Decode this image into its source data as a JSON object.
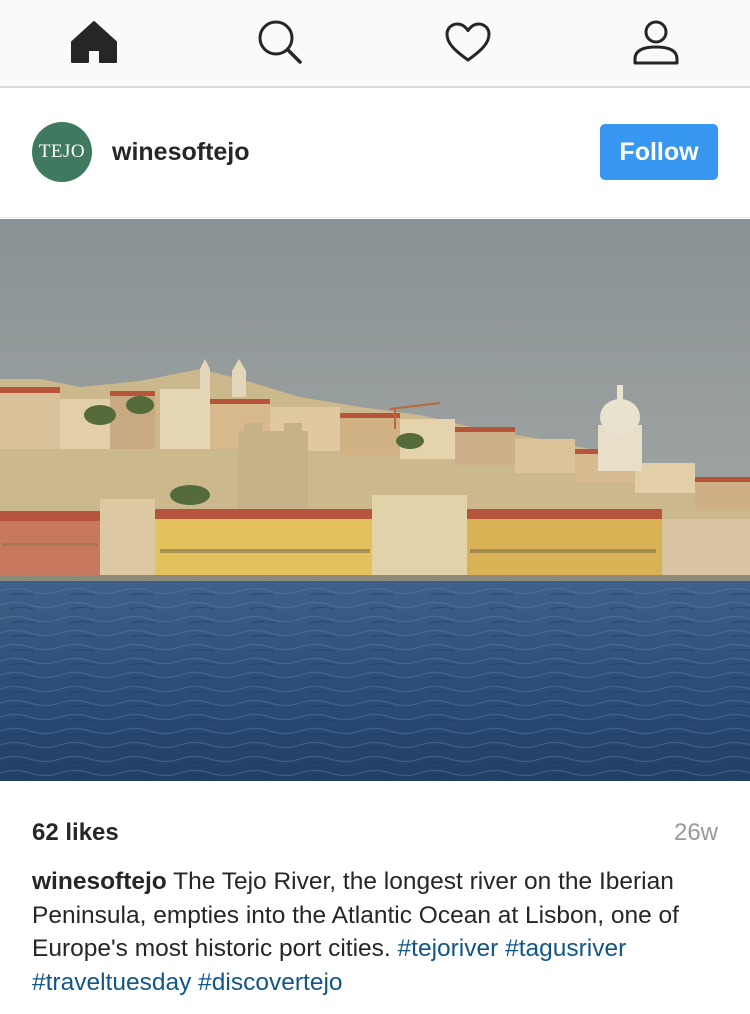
{
  "nav": {
    "items": [
      {
        "name": "home",
        "icon": "home-icon",
        "active": true
      },
      {
        "name": "search",
        "icon": "search-icon",
        "active": false
      },
      {
        "name": "activity",
        "icon": "heart-icon",
        "active": false
      },
      {
        "name": "profile",
        "icon": "profile-icon",
        "active": false
      }
    ]
  },
  "post": {
    "avatar_text": "TEJO",
    "username": "winesoftejo",
    "follow_label": "Follow",
    "likes": "62 likes",
    "timestamp": "26w",
    "caption": {
      "user": "winesoftejo",
      "text": "The Tejo River, the longest river on the Iberian Peninsula, empties into the Atlantic Ocean at Lisbon, one of Europe's most historic port cities.",
      "hashtags": [
        "#tejoriver",
        "#tagusriver",
        "#traveltuesday",
        "#discovertejo"
      ]
    }
  },
  "colors": {
    "accent": "#3897f0",
    "hashtag": "#125688",
    "avatar_bg": "#3f7a60",
    "muted": "#999999"
  }
}
